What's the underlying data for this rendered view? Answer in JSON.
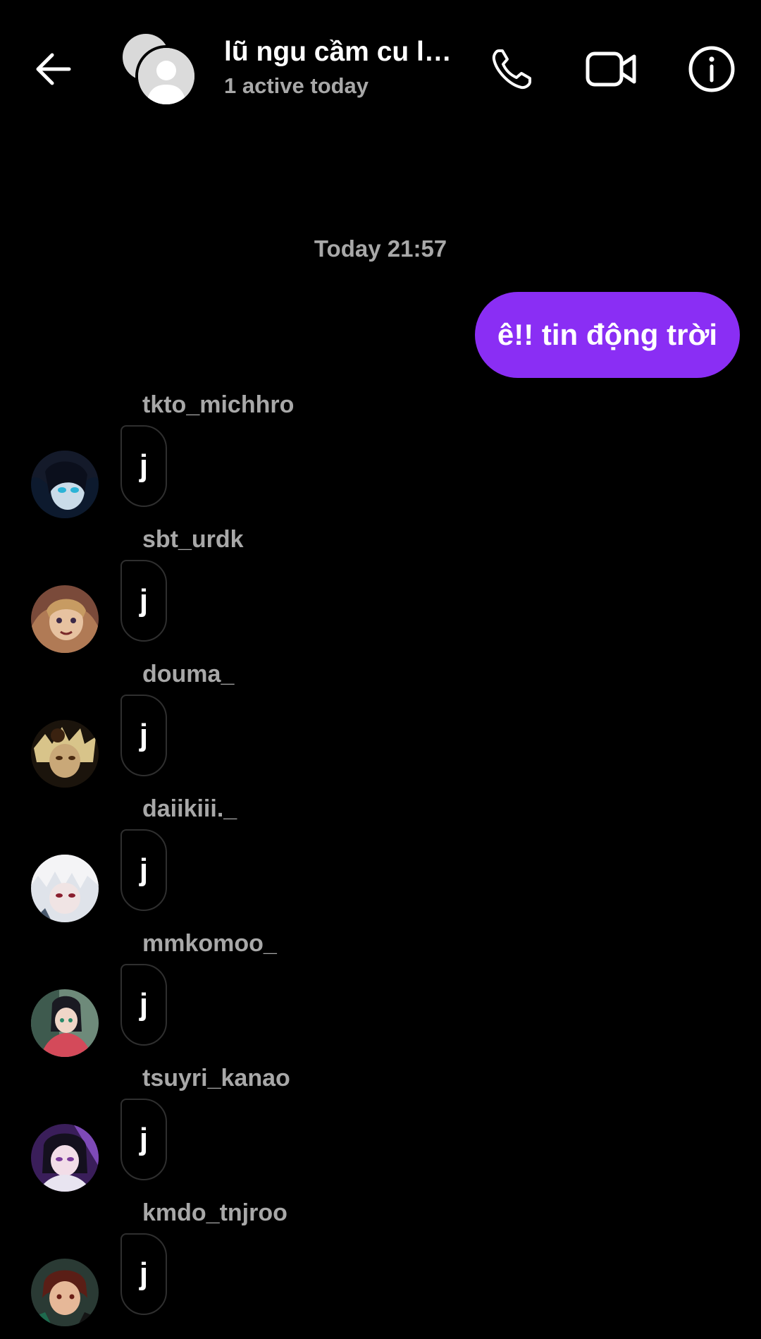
{
  "header": {
    "title": "lũ ngu cầm cu là ...",
    "status": "1 active today",
    "accent_color": "#8a2ef4",
    "icons": [
      "back-arrow-icon",
      "group-avatar",
      "phone-icon",
      "video-camera-icon",
      "info-icon"
    ]
  },
  "thread": {
    "timestamp": "Today 21:57",
    "sent_message": "ê!! tin động trời",
    "messages": [
      {
        "sender": "tkto_michhro",
        "text": "j"
      },
      {
        "sender": "sbt_urdk",
        "text": "j"
      },
      {
        "sender": "douma_",
        "text": "j"
      },
      {
        "sender": "daiikiii._",
        "text": "j"
      },
      {
        "sender": "mmkomoo_",
        "text": "j"
      },
      {
        "sender": "tsuyri_kanao",
        "text": "j"
      },
      {
        "sender": "kmdo_tnjroo",
        "text": "j"
      }
    ]
  }
}
